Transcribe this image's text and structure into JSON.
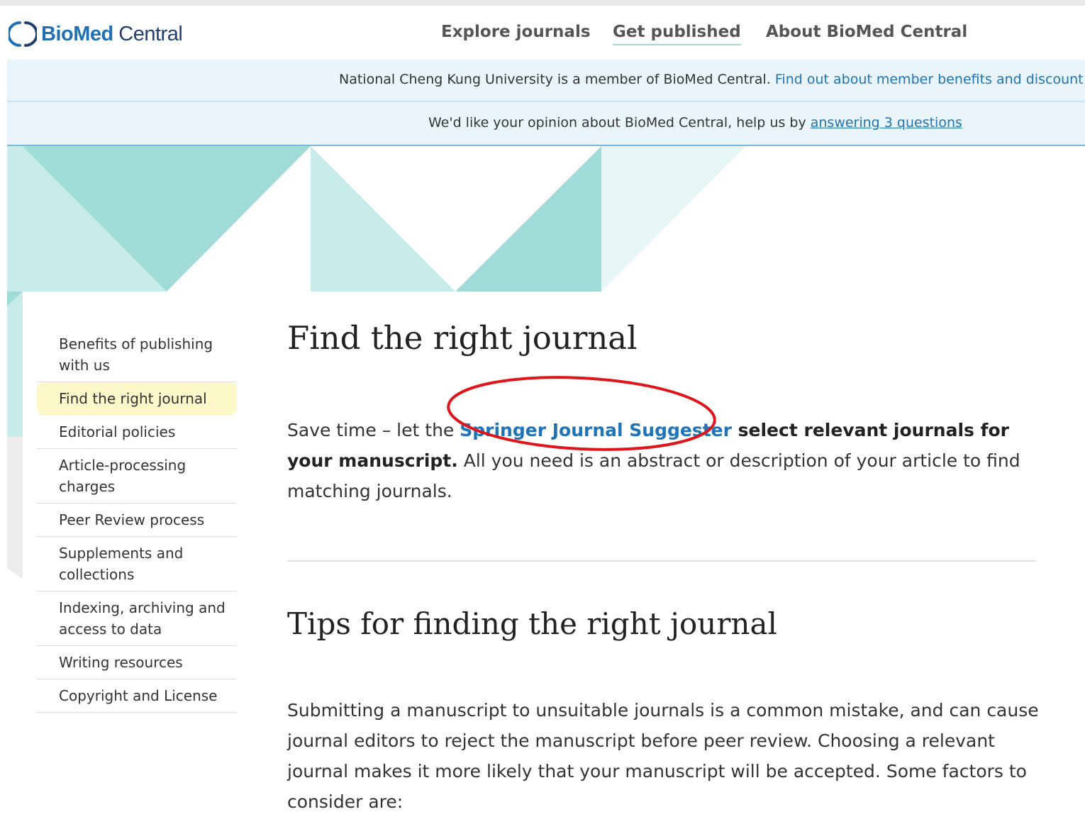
{
  "header": {
    "logo": {
      "bold": "BioMed",
      "light": " Central"
    },
    "nav": [
      "Explore journals",
      "Get published",
      "About BioMed Central"
    ]
  },
  "banners": {
    "member": {
      "text": "National Cheng Kung University is a member of BioMed Central. ",
      "link": "Find out about member benefits and discount"
    },
    "survey": {
      "text": "We'd like your opinion about BioMed Central, help us by ",
      "link": "answering 3 questions"
    }
  },
  "sidebar": {
    "items": [
      {
        "label": "Benefits of publishing with us"
      },
      {
        "label": "Find the right journal",
        "active": true
      },
      {
        "label": "Editorial policies"
      },
      {
        "label": "Article-processing charges"
      },
      {
        "label": "Peer Review process"
      },
      {
        "label": "Supplements and collections"
      },
      {
        "label": "Indexing, archiving and access to data"
      },
      {
        "label": "Writing resources"
      },
      {
        "label": "Copyright and License"
      }
    ]
  },
  "main": {
    "title": "Find the right journal",
    "intro": {
      "pre": "Save time – let the ",
      "link": "Springer Journal Suggester",
      "bold": " select relevant journals for your manuscript.",
      "post": " All you need is an abstract or description of your article to find matching journals."
    },
    "tips_title": "Tips for finding the right journal",
    "tips_text": "Submitting a manuscript to unsuitable journals is a common mistake, and can cause journal editors to reject the manuscript before peer review. Choosing a relevant journal makes it more likely that your manuscript will be accepted. Some factors to consider are:"
  },
  "colors": {
    "accent": "#1f73b7",
    "teal": "#9fdbd7",
    "teal_light": "#c7ebe8",
    "highlight": "#fdf8c9",
    "annotation": "#e0151b"
  }
}
